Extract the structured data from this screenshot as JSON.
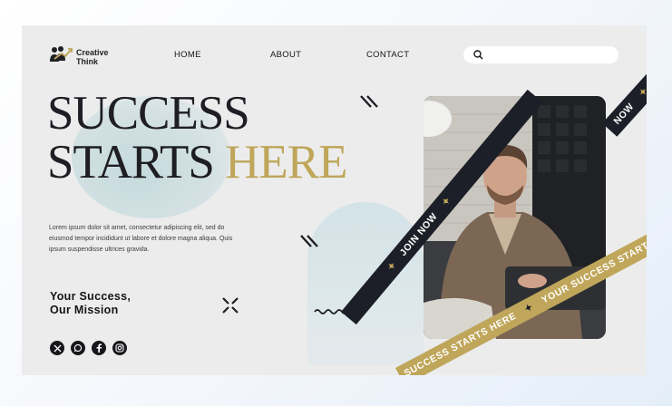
{
  "brand": {
    "line1": "Creative",
    "line2": "Think",
    "icon": "people-growth-icon"
  },
  "nav": {
    "home": "HOME",
    "about": "ABOUT",
    "contact": "CONTACT"
  },
  "search": {
    "placeholder": "",
    "icon": "search-icon"
  },
  "hero": {
    "line1": "SUCCESS",
    "line2_main": "STARTS",
    "line2_accent": "HERE"
  },
  "body_text": "Lorem ipsum dolor sit amet, consectetur adipiscing elit, sed do eiusmod tempor incididunt ut labore et dolore magna aliqua. Quis ipsum suspendisse ultrices gravida.",
  "mission": {
    "line1": "Your Success,",
    "line2": "Our Mission"
  },
  "social": [
    "x-icon",
    "whatsapp-icon",
    "facebook-icon",
    "instagram-icon"
  ],
  "ribbons": {
    "gold": "SUCCESS STARTS HERE",
    "dark": "JOIN NOW",
    "gold_alt": "YOUR SUCCESS STARTS",
    "dark_corner": "NOW"
  },
  "colors": {
    "accent": "#bfa65a",
    "dark": "#1e1e24",
    "panel": "#ececec",
    "blob": "#d3e1e3"
  }
}
